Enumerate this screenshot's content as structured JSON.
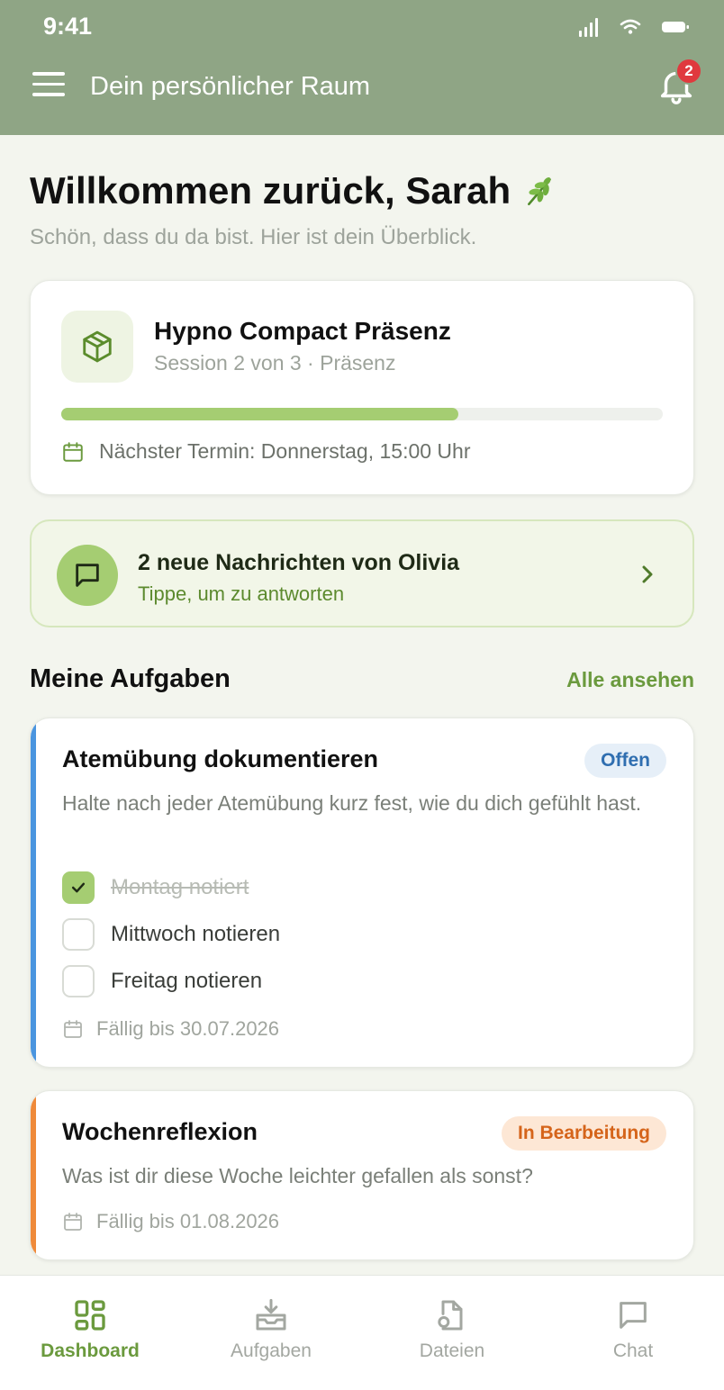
{
  "status_bar": {
    "time": "9:41"
  },
  "header": {
    "title": "Dein persönlicher Raum",
    "notification_count": "2"
  },
  "welcome": {
    "title": "Willkommen zurück, Sarah",
    "subtitle": "Schön, dass du da bist. Hier ist dein Überblick."
  },
  "course": {
    "title": "Hypno Compact Präsenz",
    "subtitle": "Session 2 von 3 · Präsenz",
    "progress": 0.66,
    "next_appointment": "Nächster Termin: Donnerstag, 15:00 Uhr"
  },
  "messages": {
    "title": "2 neue Nachrichten von Olivia",
    "subtitle": "Tippe, um zu antworten"
  },
  "tasks_section": {
    "title": "Meine Aufgaben",
    "link": "Alle ansehen"
  },
  "tasks": [
    {
      "title": "Atemübung dokumentieren",
      "status": "Offen",
      "description": "Halte nach jeder Atemübung kurz fest, wie du dich gefühlt hast.",
      "checklist": [
        {
          "label": "Montag notiert",
          "checked": true
        },
        {
          "label": "Mittwoch notieren",
          "checked": false
        },
        {
          "label": "Freitag notieren",
          "checked": false
        }
      ],
      "due": "Fällig bis 30.07.2026",
      "accent_color": "#4a95df"
    },
    {
      "title": "Wochenreflexion",
      "status": "In Bearbeitung",
      "description": "Was ist dir diese Woche leichter gefallen als sonst?",
      "due": "Fällig bis 01.08.2026",
      "accent_color": "#ef8a3a"
    }
  ],
  "bottom_nav": [
    {
      "label": "Dashboard",
      "icon": "dashboard-icon",
      "active": true
    },
    {
      "label": "Aufgaben",
      "icon": "inbox-download-icon",
      "active": false
    },
    {
      "label": "Dateien",
      "icon": "file-icon",
      "active": false
    },
    {
      "label": "Chat",
      "icon": "chat-icon",
      "active": false
    }
  ],
  "colors": {
    "header": "#8fa585",
    "accent_green": "#a5cd72",
    "link_green": "#6b9a3e"
  }
}
